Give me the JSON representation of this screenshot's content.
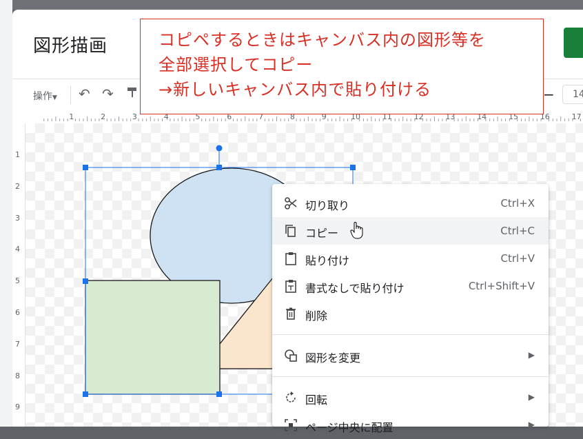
{
  "dialog": {
    "title": "図形描画"
  },
  "toolbar": {
    "actions_label": "操作",
    "font_size_value": "14"
  },
  "ruler": {
    "top_numbers": [
      "1",
      "2",
      "3",
      "4",
      "5",
      "6",
      "7",
      "8",
      "9",
      "10",
      "11",
      "12",
      "13",
      "14",
      "15",
      "16",
      "17"
    ],
    "left_numbers": [
      "1",
      "2",
      "3",
      "4",
      "5",
      "6",
      "7",
      "8",
      "9"
    ]
  },
  "callout": {
    "lines": [
      "コピペするときはキャンバス内の図形等を",
      "全部選択してコピー",
      "→新しいキャンバス内で貼り付ける"
    ]
  },
  "context_menu": {
    "items": [
      {
        "icon": "scissors-icon",
        "label": "切り取り",
        "shortcut": "Ctrl+X"
      },
      {
        "icon": "copy-icon",
        "label": "コピー",
        "shortcut": "Ctrl+C"
      },
      {
        "icon": "clipboard-icon",
        "label": "貼り付け",
        "shortcut": "Ctrl+V"
      },
      {
        "icon": "paste-plain-icon",
        "label": "書式なしで貼り付け",
        "shortcut": "Ctrl+Shift+V"
      },
      {
        "icon": "trash-icon",
        "label": "削除",
        "shortcut": ""
      },
      {
        "icon": "shapes-icon",
        "label": "図形を変更",
        "shortcut": ""
      },
      {
        "icon": "rotate-icon",
        "label": "回転",
        "shortcut": ""
      },
      {
        "icon": "center-icon",
        "label": "ページ中央に配置",
        "shortcut": ""
      }
    ],
    "hovered_item": "コピー"
  },
  "colors": {
    "callout_red": "#d93025",
    "selection_blue": "#1a73e8",
    "ellipse_fill": "#cfe2f3",
    "rectangle_fill": "#d9ead3",
    "triangle_fill": "#fce5cd",
    "save_green": "#188038"
  }
}
